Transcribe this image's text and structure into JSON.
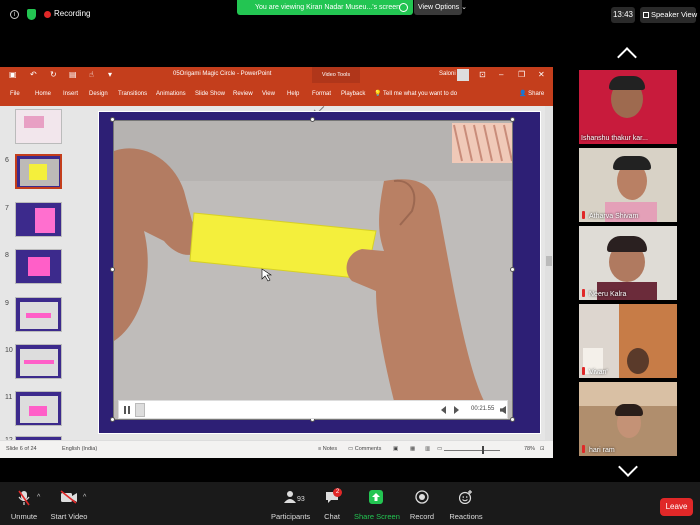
{
  "zoom_top": {
    "recording_label": "Recording",
    "viewing_banner": "You are viewing Kiran Nadar Museu...'s screen",
    "view_options_label": "View Options",
    "time": "13:43",
    "speaker_view_label": "Speaker View"
  },
  "powerpoint": {
    "doc_title": "05Origami Magic Circle  -  PowerPoint",
    "video_tools_label": "Video Tools",
    "user_name": "Saloni",
    "menu": [
      "File",
      "Home",
      "Insert",
      "Design",
      "Transitions",
      "Animations",
      "Slide Show",
      "Review",
      "View",
      "Help",
      "Format",
      "Playback"
    ],
    "tell_me": "Tell me what you want to do",
    "share_label": "Share",
    "slide_numbers": [
      "6",
      "7",
      "8",
      "9",
      "10",
      "11",
      "12"
    ],
    "video_time": "00:21.55",
    "status": {
      "slide_of": "Slide 6 of 24",
      "language": "English (India)",
      "notes": "Notes",
      "comments": "Comments",
      "zoom": "78%"
    }
  },
  "participants": [
    {
      "name": "Ishanshu thakur kar...",
      "bg": "#c81b3c",
      "muted": false
    },
    {
      "name": "Atharva Shivam",
      "bg": "#d8d2c6",
      "muted": true
    },
    {
      "name": "Neeru Kalra",
      "bg": "#dfdcd6",
      "muted": true
    },
    {
      "name": "Vivan'",
      "bg": "#c77c47",
      "muted": true
    },
    {
      "name": "hari ram",
      "bg": "#b08e6d",
      "muted": true
    }
  ],
  "toolbar": {
    "unmute": "Unmute",
    "start_video": "Start Video",
    "participants": "Participants",
    "participant_count": "93",
    "chat": "Chat",
    "chat_badge": "2",
    "share_screen": "Share Screen",
    "record": "Record",
    "reactions": "Reactions",
    "leave": "Leave"
  },
  "colors": {
    "ppt_accent": "#c43e1c",
    "zoom_green": "#23c552",
    "leave_red": "#e02828"
  }
}
